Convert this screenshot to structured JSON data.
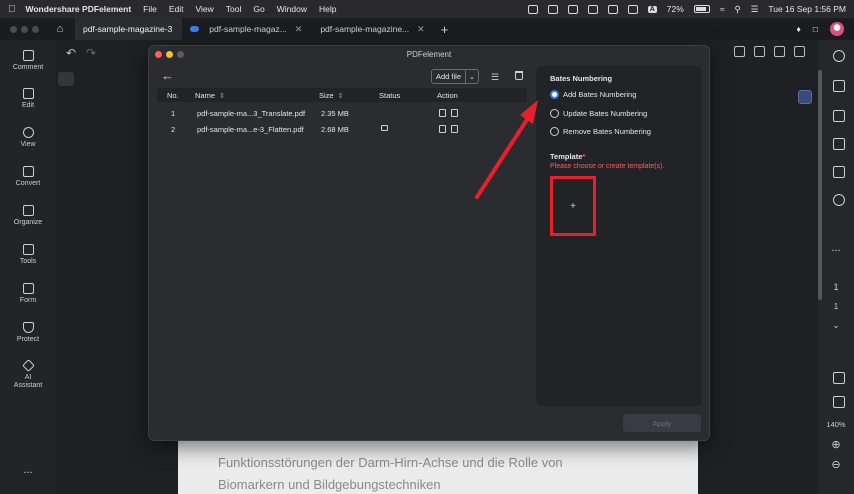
{
  "menubar": {
    "app_name": "Wondershare PDFelement",
    "items": [
      "File",
      "Edit",
      "View",
      "Tool",
      "Go",
      "Window",
      "Help"
    ],
    "battery": "72%",
    "ai_label": "A",
    "datetime": "Tue 16 Sep  1:56 PM"
  },
  "tabs": [
    {
      "label": "pdf-sample-magazine-3"
    },
    {
      "label": "pdf-sample-magaz..."
    },
    {
      "label": "pdf-sample-magazine..."
    }
  ],
  "sidebar": {
    "items": [
      {
        "label": "Comment"
      },
      {
        "label": "Edit"
      },
      {
        "label": "View"
      },
      {
        "label": "Convert"
      },
      {
        "label": "Organize"
      },
      {
        "label": "Tools"
      },
      {
        "label": "Form"
      },
      {
        "label": "Protect"
      },
      {
        "label": "AI\nAssistant"
      }
    ],
    "more": "..."
  },
  "dialog": {
    "title": "PDFelement",
    "add_file": "Add file",
    "columns": {
      "no": "No.",
      "name": "Name",
      "size": "Size",
      "status": "Status",
      "action": "Action"
    },
    "files": [
      {
        "no": "1",
        "name": "pdf-sample-ma...3_Translate.pdf",
        "size": "2.35 MB",
        "locked": false
      },
      {
        "no": "2",
        "name": "pdf-sample-ma...e-3_Flatten.pdf",
        "size": "2.68 MB",
        "locked": true
      }
    ],
    "panel": {
      "heading": "Bates Numbering",
      "options": [
        {
          "label": "Add Bates Numbering",
          "selected": true
        },
        {
          "label": "Update Bates Numbering",
          "selected": false
        },
        {
          "label": "Remove Bates Numbering",
          "selected": false
        }
      ],
      "template_label": "Template",
      "template_required": "*",
      "template_error": "Please choose or create template(s).",
      "template_add": "+"
    },
    "apply": "Apply"
  },
  "right_panel": {
    "page_current": "1",
    "page_total": "1",
    "zoom": "140%",
    "more": "..."
  },
  "document": {
    "line1": "Funktionsstörungen der Darm-Hirn-Achse und die Rolle von",
    "line2": "Biomarkern und Bildgebungstechniken"
  },
  "colors": {
    "accent": "#3a7df0",
    "error": "#ff5a5a",
    "highlight": "#e8202a"
  }
}
